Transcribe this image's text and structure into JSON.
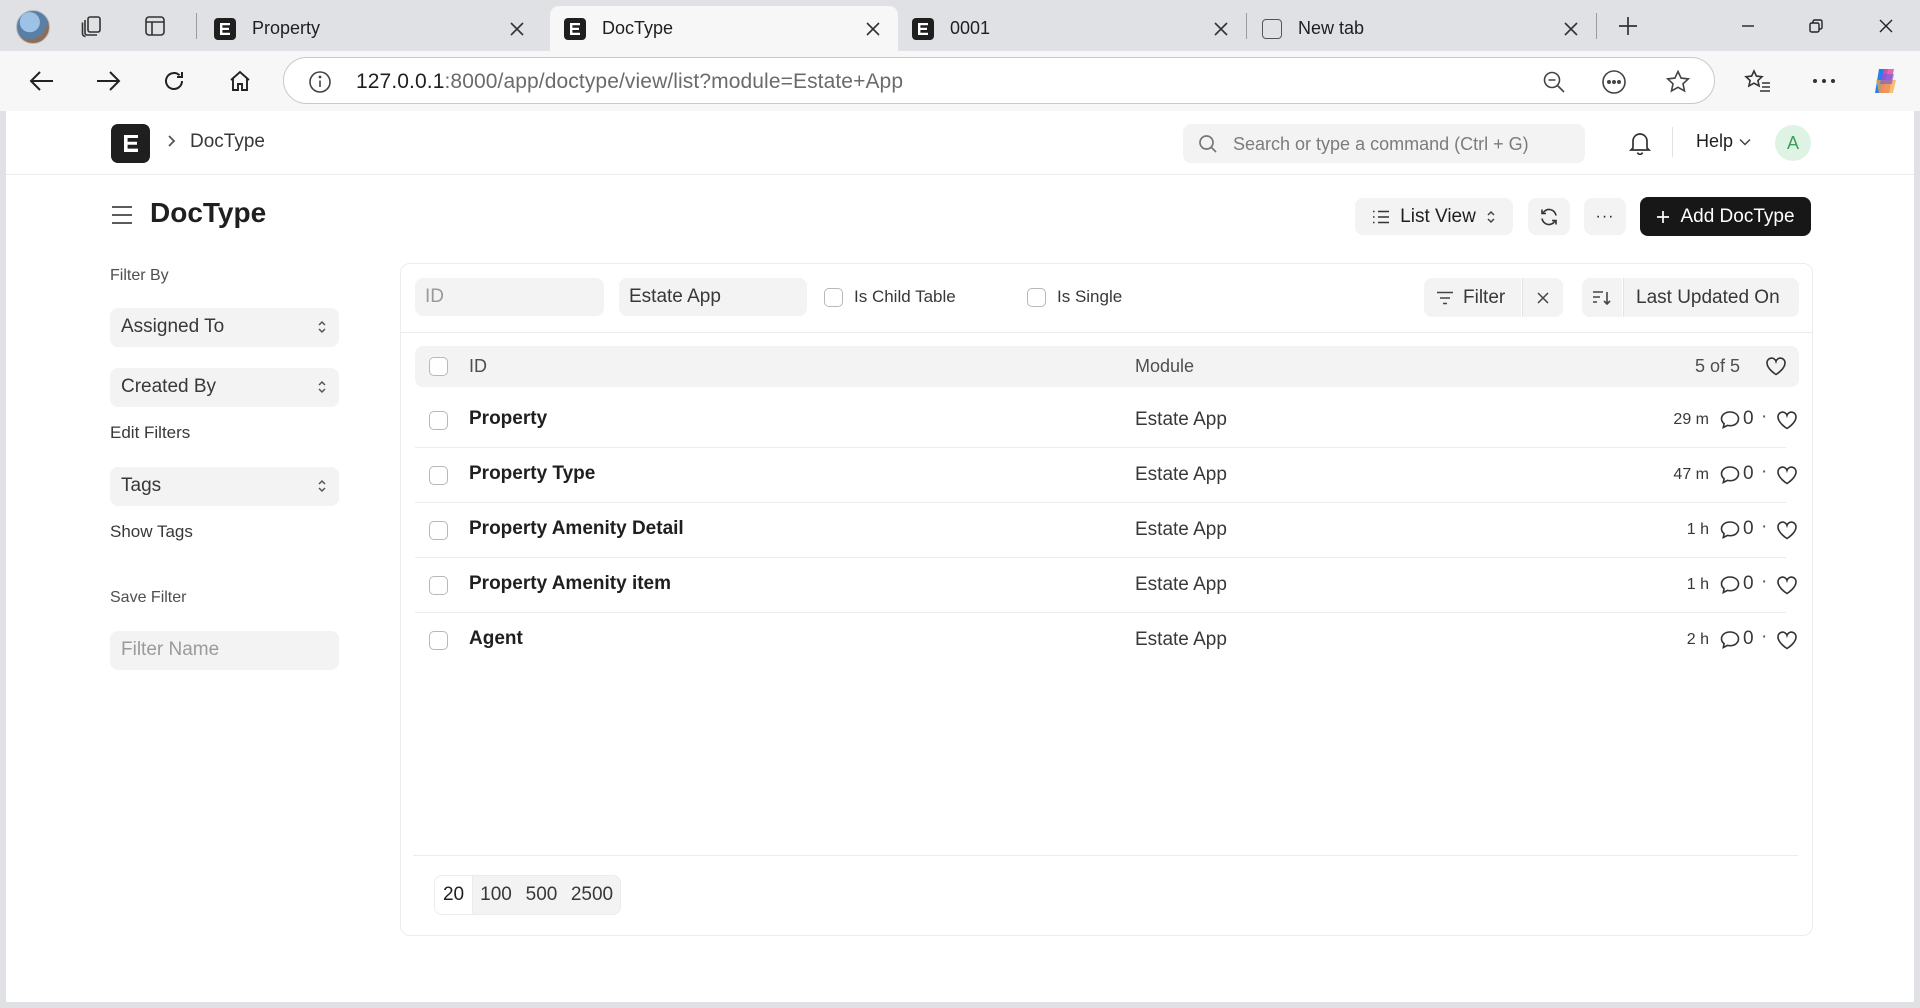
{
  "browser": {
    "tabs": [
      {
        "title": "Property",
        "favicon": "frappe-e-icon"
      },
      {
        "title": "DocType",
        "favicon": "frappe-e-icon",
        "active": true
      },
      {
        "title": "0001",
        "favicon": "frappe-e-icon"
      },
      {
        "title": "New tab",
        "favicon": "new-tab-icon"
      }
    ],
    "url_host": "127.0.0.1",
    "url_rest": ":8000/app/doctype/view/list?module=Estate+App"
  },
  "navbar": {
    "breadcrumb": "DocType",
    "search_placeholder": "Search or type a command (Ctrl + G)",
    "help_label": "Help",
    "avatar_letter": "A"
  },
  "page": {
    "title": "DocType",
    "view_label": "List View",
    "more_label": "···",
    "add_label": "Add DocType"
  },
  "sidebar": {
    "filter_by": "Filter By",
    "assigned_to": "Assigned To",
    "created_by": "Created By",
    "edit_filters": "Edit Filters",
    "tags": "Tags",
    "show_tags": "Show Tags",
    "save_filter": "Save Filter",
    "filter_name_placeholder": "Filter Name"
  },
  "filters": {
    "id_placeholder": "ID",
    "module_value": "Estate App",
    "is_child_table": "Is Child Table",
    "is_single": "Is Single",
    "filter_label": "Filter",
    "sort_label": "Last Updated On"
  },
  "list": {
    "col_id": "ID",
    "col_module": "Module",
    "count": "5 of 5",
    "rows": [
      {
        "name": "Property",
        "module": "Estate App",
        "modified": "29 m",
        "comments": "0"
      },
      {
        "name": "Property Type",
        "module": "Estate App",
        "modified": "47 m",
        "comments": "0"
      },
      {
        "name": "Property Amenity Detail",
        "module": "Estate App",
        "modified": "1 h",
        "comments": "0"
      },
      {
        "name": "Property Amenity item",
        "module": "Estate App",
        "modified": "1 h",
        "comments": "0"
      },
      {
        "name": "Agent",
        "module": "Estate App",
        "modified": "2 h",
        "comments": "0"
      }
    ]
  },
  "pager": {
    "sizes": [
      "20",
      "100",
      "500",
      "2500"
    ],
    "selected": "20"
  },
  "colors": {
    "primary_button": "#171717",
    "control_bg": "#f3f3f3",
    "avatar_bg": "#dff3e4",
    "avatar_fg": "#3a9f57"
  }
}
